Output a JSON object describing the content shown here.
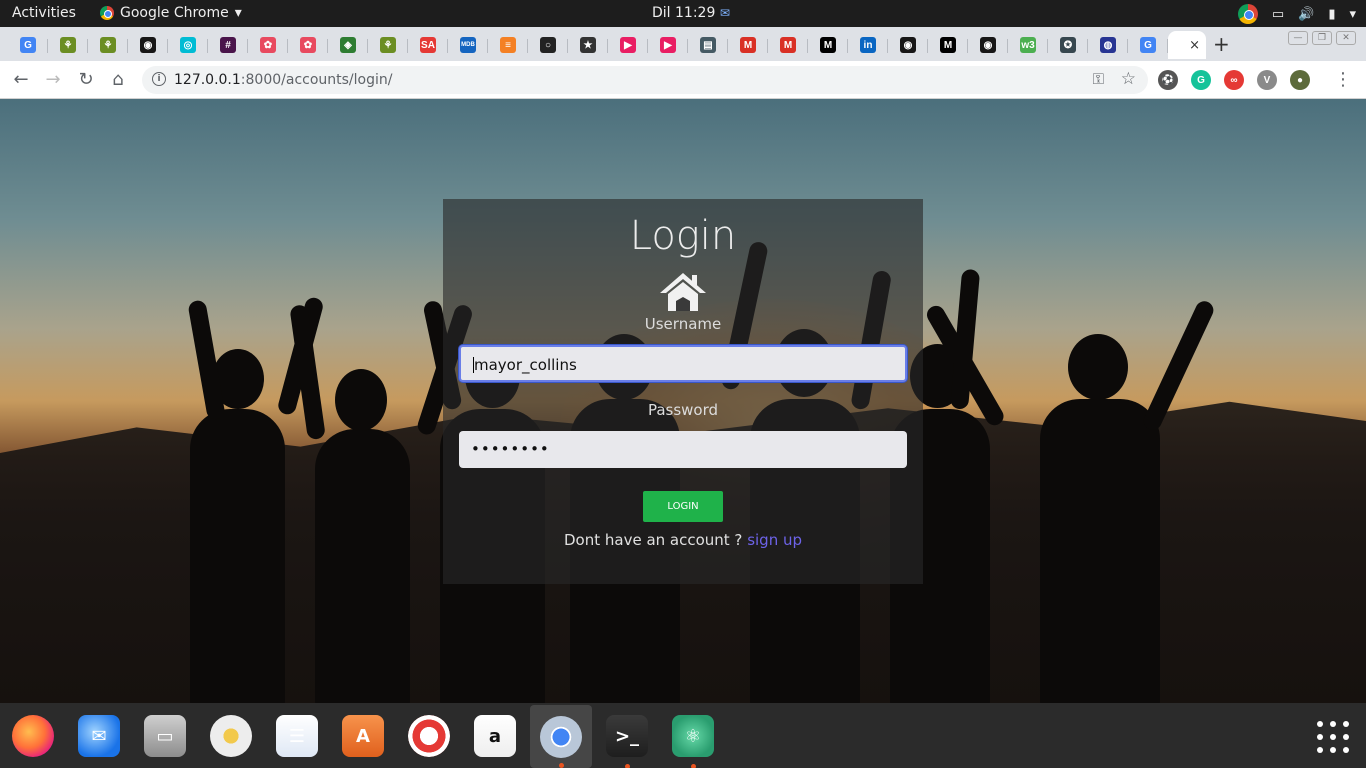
{
  "topbar": {
    "activities": "Activities",
    "app_name": "Google Chrome",
    "app_menu_arrow": "▾",
    "clock": "Dil 11:29",
    "clock_icon": "mail-icon"
  },
  "browser": {
    "tabs": [
      {
        "icon": "google-icon",
        "color": "#4285f4",
        "glyph": "G"
      },
      {
        "icon": "palm-tree-icon",
        "color": "#6b8e23",
        "glyph": "⚘"
      },
      {
        "icon": "palm-tree-icon",
        "color": "#6b8e23",
        "glyph": "⚘"
      },
      {
        "icon": "github-icon",
        "color": "#181717",
        "glyph": "◉"
      },
      {
        "icon": "colorful-ring-icon",
        "color": "#00bcd4",
        "glyph": "◎"
      },
      {
        "icon": "slack-icon",
        "color": "#4a154b",
        "glyph": "#"
      },
      {
        "icon": "ornament-icon",
        "color": "#e84a5f",
        "glyph": "✿"
      },
      {
        "icon": "ornament-icon",
        "color": "#e84a5f",
        "glyph": "✿"
      },
      {
        "icon": "diamond-icon",
        "color": "#2e7d32",
        "glyph": "◈"
      },
      {
        "icon": "palm-tree-icon",
        "color": "#6b8e23",
        "glyph": "⚘"
      },
      {
        "icon": "sa-icon",
        "color": "#e53935",
        "glyph": "SA"
      },
      {
        "icon": "mdb-icon",
        "color": "#1565c0",
        "glyph": "MDB"
      },
      {
        "icon": "stackoverflow-icon",
        "color": "#f48024",
        "glyph": "≡"
      },
      {
        "icon": "circle-logo-icon",
        "color": "#222222",
        "glyph": "○"
      },
      {
        "icon": "star-icon",
        "color": "#333333",
        "glyph": "★"
      },
      {
        "icon": "play-icon",
        "color": "#e91e63",
        "glyph": "▶"
      },
      {
        "icon": "play-icon",
        "color": "#e91e63",
        "glyph": "▶"
      },
      {
        "icon": "book-icon",
        "color": "#455a64",
        "glyph": "▤"
      },
      {
        "icon": "gmail-icon",
        "color": "#d93025",
        "glyph": "M"
      },
      {
        "icon": "gmail-icon",
        "color": "#d93025",
        "glyph": "M"
      },
      {
        "icon": "medium-icon",
        "color": "#000000",
        "glyph": "M"
      },
      {
        "icon": "linkedin-icon",
        "color": "#0a66c2",
        "glyph": "in"
      },
      {
        "icon": "github-icon",
        "color": "#181717",
        "glyph": "◉"
      },
      {
        "icon": "medium-icon",
        "color": "#000000",
        "glyph": "M"
      },
      {
        "icon": "github-icon",
        "color": "#181717",
        "glyph": "◉"
      },
      {
        "icon": "w3-icon",
        "color": "#4caf50",
        "glyph": "w3"
      },
      {
        "icon": "globe-icon",
        "color": "#37474f",
        "glyph": "✪"
      },
      {
        "icon": "user-badge-icon",
        "color": "#283593",
        "glyph": "◍"
      },
      {
        "icon": "google-icon",
        "color": "#4285f4",
        "glyph": "G"
      }
    ],
    "active_tab_close": "×",
    "new_tab": "+",
    "url_host": "127.0.0.1",
    "url_rest": ":8000/accounts/login/",
    "extensions": [
      {
        "icon": "soccer-ball-icon",
        "color": "#555555",
        "glyph": "⚽"
      },
      {
        "icon": "grammarly-icon",
        "color": "#15c39a",
        "glyph": "G"
      },
      {
        "icon": "infinity-icon",
        "color": "#e53935",
        "glyph": "∞"
      },
      {
        "icon": "vuetify-icon",
        "color": "#8a8a8a",
        "glyph": "V"
      },
      {
        "icon": "profile-avatar-icon",
        "color": "#5d6b3b",
        "glyph": "●"
      }
    ]
  },
  "login": {
    "title": "Login",
    "username_label": "Username",
    "username_value": "mayor_collins",
    "password_label": "Password",
    "password_value": "••••••••",
    "button_label": "LOGIN",
    "signup_prompt": "Dont have an account ?",
    "signup_link": "sign up"
  },
  "dock": [
    {
      "name": "firefox-icon",
      "bg": "radial-gradient(circle at 40% 40%, #ffbd4f, #ff7139 45%, #e31587 80%)",
      "glyph": "",
      "dot": false
    },
    {
      "name": "thunderbird-icon",
      "bg": "radial-gradient(circle at 40% 40%, #9fd3ff, #1a73e8 70%)",
      "glyph": "✉",
      "dot": false
    },
    {
      "name": "files-icon",
      "bg": "linear-gradient(#cfcfcf, #8d8d8d)",
      "glyph": "▭",
      "dot": false
    },
    {
      "name": "rhythmbox-icon",
      "bg": "radial-gradient(circle, #f2c94c 0 25%, #ededed 26% 100%)",
      "glyph": "",
      "dot": false
    },
    {
      "name": "libreoffice-writer-icon",
      "bg": "linear-gradient(#ffffff, #dfe8f5)",
      "glyph": "☰",
      "dot": false
    },
    {
      "name": "software-center-icon",
      "bg": "linear-gradient(#f7934c, #e0601d)",
      "glyph": "A",
      "dot": false
    },
    {
      "name": "help-icon",
      "bg": "radial-gradient(circle, #ffffff 0 30%, #e53935 31% 55%, #ffffff 56% 70%, #e53935 71%)",
      "glyph": "",
      "dot": false
    },
    {
      "name": "amazon-icon",
      "bg": "linear-gradient(#ffffff, #eeeeee)",
      "glyph": "a",
      "dot": false
    },
    {
      "name": "chrome-icon",
      "bg": "radial-gradient(circle, #4285f4 0 28%, #ffffff 29% 34%, #b9c7d8 35%)",
      "glyph": "",
      "dot": true,
      "active": true
    },
    {
      "name": "terminal-icon",
      "bg": "linear-gradient(#3a3a3a, #1e1e1e)",
      "glyph": ">_",
      "dot": true
    },
    {
      "name": "atom-icon",
      "bg": "radial-gradient(circle, #66d9a8, #2a9d6f 70%)",
      "glyph": "⚛",
      "dot": true
    }
  ]
}
